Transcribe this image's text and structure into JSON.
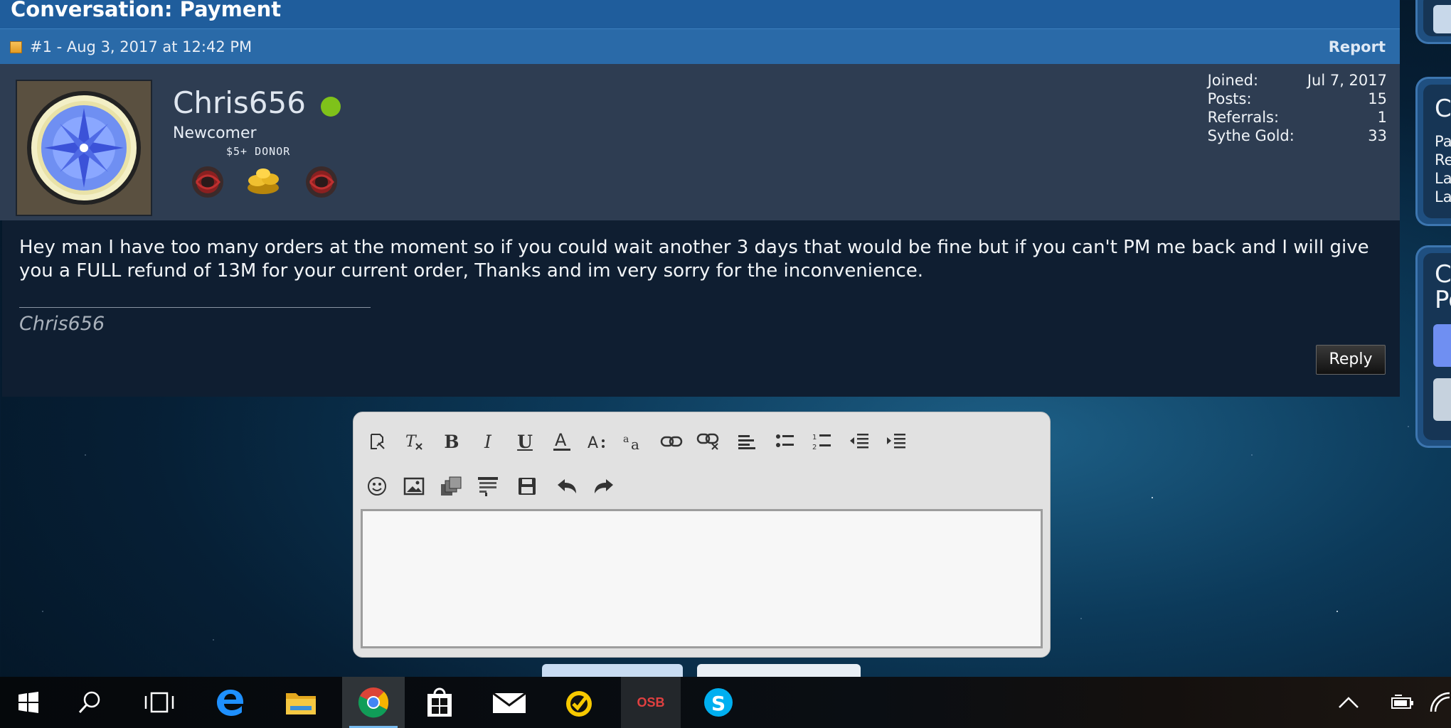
{
  "conversation": {
    "title": "Conversation: Payment"
  },
  "post": {
    "number_date": "#1 - Aug 3, 2017 at 12:42 PM",
    "report_label": "Report",
    "username": "Chris656",
    "rank": "Newcomer",
    "donor_label": "$5+ DONOR",
    "stats": [
      {
        "label": "Joined:",
        "value": "Jul 7, 2017"
      },
      {
        "label": "Posts:",
        "value": "15"
      },
      {
        "label": "Referrals:",
        "value": "1"
      },
      {
        "label": "Sythe Gold:",
        "value": "33"
      }
    ],
    "message": "Hey man I have too many orders at the moment so if you could wait another 3 days that would be fine but if you can't PM me back and I will give you a FULL refund of 13M for your current order, Thanks and im very sorry for the inconvenience.",
    "signature": "Chris656",
    "reply_label": "Reply"
  },
  "sidebar": {
    "box2_heading": "C",
    "box2_lines": [
      "Pa",
      "Re",
      "La",
      "La"
    ],
    "box3_heading": [
      "C",
      "Po"
    ]
  },
  "editor": {
    "row1_tools": [
      "switch-editor-icon",
      "remove-format-icon",
      "bold-icon",
      "italic-icon",
      "underline-icon",
      "text-color-icon",
      "font-size-icon",
      "font-family-icon",
      "link-icon",
      "unlink-icon",
      "align-icon",
      "bullet-list-icon",
      "numbered-list-icon",
      "outdent-icon",
      "indent-icon"
    ],
    "row2_tools": [
      "smilies-icon",
      "image-icon",
      "media-icon",
      "quote-icon",
      "save-draft-icon",
      "undo-icon",
      "redo-icon"
    ],
    "text_value": ""
  },
  "taskbar": {
    "apps": [
      "windows-start-icon",
      "search-icon",
      "task-view-icon",
      "edge-icon",
      "file-explorer-icon",
      "chrome-icon",
      "store-icon",
      "mail-icon",
      "norton-icon",
      "osbuddy-icon",
      "skype-icon"
    ],
    "osb_label": "OSB"
  },
  "colors": {
    "header_blue": "#1f5d9c",
    "online_green": "#7fc21a"
  }
}
